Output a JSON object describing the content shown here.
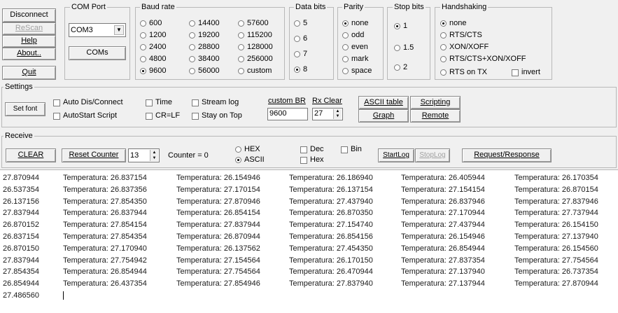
{
  "left_buttons": {
    "disconnect": "Disconnect",
    "rescan": "ReScan",
    "help": "Help",
    "about": "About..",
    "quit": "Quit"
  },
  "com_port": {
    "group_label": "COM Port",
    "selected": "COM3",
    "coms_button": "COMs"
  },
  "baud_rate": {
    "group_label": "Baud rate",
    "options": [
      "600",
      "1200",
      "2400",
      "4800",
      "9600",
      "14400",
      "19200",
      "28800",
      "38400",
      "56000",
      "57600",
      "115200",
      "128000",
      "256000",
      "custom"
    ],
    "selected": "9600"
  },
  "data_bits": {
    "group_label": "Data bits",
    "options": [
      "5",
      "6",
      "7",
      "8"
    ],
    "selected": "8"
  },
  "parity": {
    "group_label": "Parity",
    "options": [
      "none",
      "odd",
      "even",
      "mark",
      "space"
    ],
    "selected": "none"
  },
  "stop_bits": {
    "group_label": "Stop bits",
    "options": [
      "1",
      "1.5",
      "2"
    ],
    "selected": "1"
  },
  "handshaking": {
    "group_label": "Handshaking",
    "options": [
      "none",
      "RTS/CTS",
      "XON/XOFF",
      "RTS/CTS+XON/XOFF",
      "RTS on TX"
    ],
    "selected": "none",
    "invert_label": "invert"
  },
  "settings": {
    "group_label": "Settings",
    "set_font": "Set font",
    "auto_dis_connect": "Auto Dis/Connect",
    "autostart_script": "AutoStart Script",
    "time": "Time",
    "cr_lf": "CR=LF",
    "stream_log": "Stream log",
    "stay_on_top": "Stay on Top",
    "custom_br_label": "custom BR",
    "custom_br_value": "9600",
    "rx_clear_label": "Rx Clear",
    "rx_clear_value": "27",
    "ascii_table": "ASCII table",
    "scripting": "Scripting",
    "graph": "Graph",
    "remote": "Remote"
  },
  "receive": {
    "group_label": "Receive",
    "clear": "CLEAR",
    "reset_counter": "Reset Counter",
    "counter_spin": "13",
    "counter_label": "Counter = 0",
    "hex": "HEX",
    "ascii": "ASCII",
    "format_selected": "ASCII",
    "dec": "Dec",
    "hex_chk": "Hex",
    "bin": "Bin",
    "startlog": "StartLog",
    "stoplog": "StopLog",
    "request_response": "Request/Response"
  },
  "terminal": {
    "rows": [
      [
        "27.870944",
        "Temperatura: 26.837154",
        "Temperatura: 26.154946",
        "Temperatura: 26.186940",
        "Temperatura: 26.405944",
        "Temperatura: 26.170354"
      ],
      [
        "26.537354",
        "Temperatura: 26.837356",
        "Temperatura: 27.170154",
        "Temperatura: 26.137154",
        "Temperatura: 27.154154",
        "Temperatura: 26.870154"
      ],
      [
        "26.137156",
        "Temperatura: 27.854350",
        "Temperatura: 27.870946",
        "Temperatura: 27.437940",
        "Temperatura: 26.837946",
        "Temperatura: 27.837946"
      ],
      [
        "27.837944",
        "Temperatura: 26.837944",
        "Temperatura: 26.854154",
        "Temperatura: 26.870350",
        "Temperatura: 27.170944",
        "Temperatura: 27.737944"
      ],
      [
        "26.870152",
        "Temperatura: 27.854154",
        "Temperatura: 27.837944",
        "Temperatura: 27.154740",
        "Temperatura: 27.437944",
        "Temperatura: 26.154150"
      ],
      [
        "26.837154",
        "Temperatura: 27.854354",
        "Temperatura: 26.870944",
        "Temperatura: 26.854156",
        "Temperatura: 26.154946",
        "Temperatura: 27.137940"
      ],
      [
        "26.870150",
        "Temperatura: 27.170940",
        "Temperatura: 26.137562",
        "Temperatura: 27.454350",
        "Temperatura: 26.854944",
        "Temperatura: 26.154560"
      ],
      [
        "27.837944",
        "Temperatura: 27.754942",
        "Temperatura: 27.154564",
        "Temperatura: 26.170150",
        "Temperatura: 27.837354",
        "Temperatura: 27.754564"
      ],
      [
        "27.854354",
        "Temperatura: 26.854944",
        "Temperatura: 27.754564",
        "Temperatura: 26.470944",
        "Temperatura: 27.137940",
        "Temperatura: 26.737354"
      ],
      [
        "26.854944",
        "Temperatura: 26.437354",
        "Temperatura: 27.854946",
        "Temperatura: 27.837940",
        "Temperatura: 27.137944",
        "Temperatura: 27.870944"
      ],
      [
        "27.486560",
        "",
        "",
        "",
        "",
        ""
      ]
    ]
  }
}
